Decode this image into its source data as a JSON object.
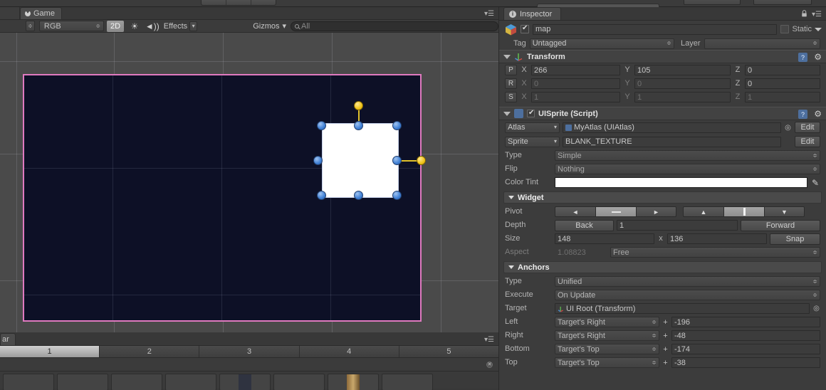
{
  "window": {
    "top_toolbar": {
      "transport_buttons": [
        "play-icon",
        "pause-icon",
        "step-icon"
      ],
      "right_dropdowns": [
        "",
        ""
      ]
    }
  },
  "game_panel": {
    "tab": {
      "label": "Game",
      "icon": "game-pacman-icon"
    },
    "menu_icon": "panel-menu-icon",
    "toolbar": {
      "display_stepper": "",
      "aspect": "RGB",
      "mode_2d": "2D",
      "lighting_icon": "sun-icon",
      "audio_icon": "mute-audio-icon",
      "effects": "Effects",
      "gizmos": "Gizmos",
      "search_placeholder": "All",
      "search_icon": "search-icon"
    },
    "viewport": {
      "background_color": "#0d1026",
      "border_color": "#e07ac0",
      "sprite_color": "#ffffff",
      "handle_color": "#3f7fd4",
      "anchor_color": "#f0c318"
    }
  },
  "bottom_panel": {
    "tab_label": "ar",
    "menu_icon": "panel-menu-icon",
    "layers": [
      "1",
      "2",
      "3",
      "4",
      "5"
    ],
    "selected_layer": "1",
    "search_value": "",
    "clear_icon": "clear-x-icon"
  },
  "inspector": {
    "tab": {
      "label": "Inspector",
      "icon": "info-icon"
    },
    "lock_icon": "lock-icon",
    "menu_icon": "panel-menu-icon",
    "object": {
      "enabled": true,
      "icon": "prefab-cube-icon",
      "name": "map",
      "static_label": "Static",
      "static_checked": false,
      "tag_label": "Tag",
      "tag_value": "Untagged",
      "layer_label": "Layer",
      "layer_value": ""
    },
    "transform": {
      "title": "Transform",
      "icon": "transform-axis-icon",
      "help_icon": "help-icon",
      "gear_icon": "gear-icon",
      "rows": [
        {
          "key": "P",
          "label_x": "X",
          "x": "266",
          "label_y": "Y",
          "y": "105",
          "label_z": "Z",
          "z": "0",
          "dim": false
        },
        {
          "key": "R",
          "label_x": "X",
          "x": "0",
          "label_y": "Y",
          "y": "0",
          "label_z": "Z",
          "z": "0",
          "dim": true
        },
        {
          "key": "S",
          "label_x": "X",
          "x": "1",
          "label_y": "Y",
          "y": "1",
          "label_z": "Z",
          "z": "1",
          "dim": true
        }
      ]
    },
    "uisprite": {
      "title": "UISprite (Script)",
      "enabled": true,
      "script_icon": "script-icon",
      "help_icon": "help-icon",
      "gear_icon": "gear-icon",
      "atlas_label": "Atlas",
      "atlas_value": "MyAtlas (UIAtlas)",
      "atlas_object_icon": "atlas-object-icon",
      "atlas_picker_icon": "object-picker-icon",
      "atlas_edit": "Edit",
      "sprite_label": "Sprite",
      "sprite_value": "BLANK_TEXTURE",
      "sprite_edit": "Edit",
      "type_label": "Type",
      "type_value": "Simple",
      "flip_label": "Flip",
      "flip_value": "Nothing",
      "color_tint_label": "Color Tint",
      "color_tint_value": "#ffffff",
      "eyedropper_icon": "eyedropper-icon"
    },
    "widget": {
      "title": "Widget",
      "pivot_label": "Pivot",
      "pivot_h": [
        "◄",
        "—",
        "►"
      ],
      "pivot_h_selected": 1,
      "pivot_v": [
        "▲",
        "|",
        "▼"
      ],
      "pivot_v_selected": 1,
      "depth_label": "Depth",
      "depth_back": "Back",
      "depth_value": "1",
      "depth_forward": "Forward",
      "size_label": "Size",
      "size_width": "148",
      "size_x": "x",
      "size_height": "136",
      "snap": "Snap",
      "aspect_label": "Aspect",
      "aspect_value": "1.08823",
      "aspect_mode": "Free"
    },
    "anchors": {
      "title": "Anchors",
      "type_label": "Type",
      "type_value": "Unified",
      "execute_label": "Execute",
      "execute_value": "On Update",
      "target_label": "Target",
      "target_value": "UI Root (Transform)",
      "target_icon": "transform-axis-icon",
      "target_picker_icon": "object-picker-icon",
      "edges": [
        {
          "label": "Left",
          "relative": "Target's Right",
          "op": "+",
          "value": "-196"
        },
        {
          "label": "Right",
          "relative": "Target's Right",
          "op": "+",
          "value": "-48"
        },
        {
          "label": "Bottom",
          "relative": "Target's Top",
          "op": "+",
          "value": "-174"
        },
        {
          "label": "Top",
          "relative": "Target's Top",
          "op": "+",
          "value": "-38"
        }
      ]
    }
  }
}
